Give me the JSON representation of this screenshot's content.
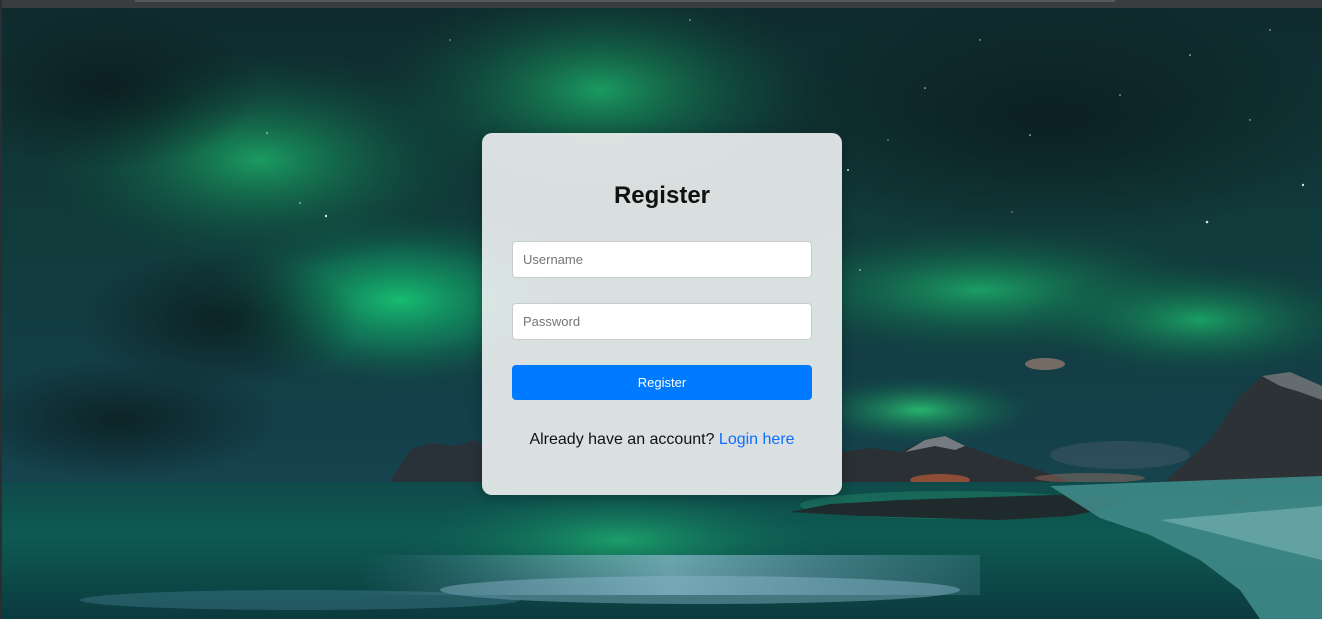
{
  "form": {
    "title": "Register",
    "username_placeholder": "Username",
    "password_placeholder": "Password",
    "submit_label": "Register",
    "login_prompt": "Already have an account?",
    "login_link": "Login here"
  },
  "colors": {
    "accent": "#007bff",
    "link": "#0d6efd",
    "card_bg": "#eef0f0"
  },
  "background": {
    "scene": "aurora-over-sea"
  }
}
